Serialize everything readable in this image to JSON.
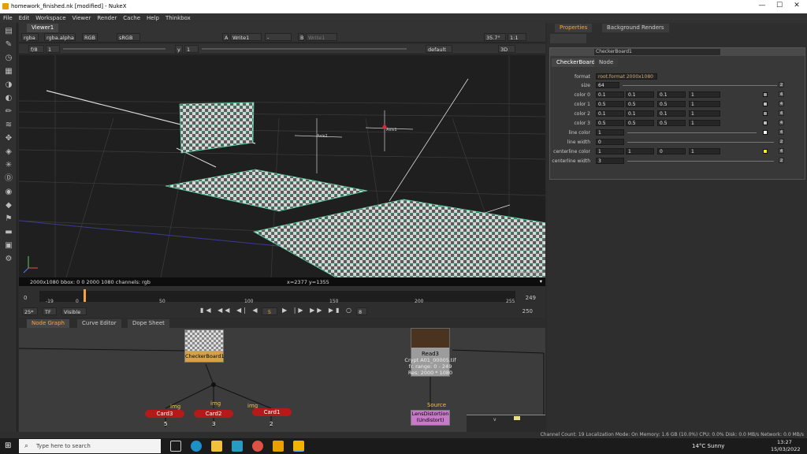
{
  "window": {
    "title": "homework_finished.nk [modified] - NukeX",
    "min": "—",
    "max": "☐",
    "close": "✕"
  },
  "menu": [
    "File",
    "Edit",
    "Workspace",
    "Viewer",
    "Render",
    "Cache",
    "Help",
    "Thinkbox"
  ],
  "viewer": {
    "tab": "Viewer1",
    "channels": "rgba",
    "alpha": "rgba.alpha",
    "colorspace_a": "RGB",
    "lut": "sRGB",
    "input_a_label": "A",
    "input_a": "Write1",
    "input_mid": "-",
    "input_b_label": "B",
    "input_b": "Write1",
    "gain_label": "f/8",
    "gain_val": "1",
    "gamma_label": "y",
    "gamma_val": "1",
    "zoom": "35.7°",
    "ratio": "1:1",
    "camera": "default",
    "mode": "3D",
    "status_left": "2000x1080  bbox: 0 0 2000 1080 channels: rgb",
    "status_mid": "x=2377 y=1355",
    "corner_label": "(2000x1080)",
    "labels": {
      "axis1": "Axis1",
      "axis2": "Axis2"
    }
  },
  "timeline": {
    "start": "0",
    "end": "249",
    "left_in": "-19",
    "right_out": "255",
    "ticks": [
      "0",
      "50",
      "100",
      "150",
      "200",
      "255"
    ],
    "fps": "25*",
    "tf": "TF",
    "visible": "Visible",
    "frame": "5",
    "step": "8",
    "end_frame": "250"
  },
  "properties": {
    "tabs": [
      "Properties",
      "Background Renders"
    ],
    "node_name": "CheckerBoard1",
    "subtabs": [
      "CheckerBoard",
      "Node"
    ],
    "format_label": "format",
    "format_value": "root.format 2000x1080",
    "size_label": "size",
    "size_value": "64",
    "rows": [
      {
        "label": "color 0",
        "v": [
          "0.1",
          "0.1",
          "0.1",
          "1"
        ],
        "chip": "#9a9a9a",
        "n": "4"
      },
      {
        "label": "color 1",
        "v": [
          "0.5",
          "0.5",
          "0.5",
          "1"
        ],
        "chip": "#bdbdbd",
        "n": "4"
      },
      {
        "label": "color 2",
        "v": [
          "0.1",
          "0.1",
          "0.1",
          "1"
        ],
        "chip": "#9a9a9a",
        "n": "4"
      },
      {
        "label": "color 3",
        "v": [
          "0.5",
          "0.5",
          "0.5",
          "1"
        ],
        "chip": "#bdbdbd",
        "n": "4"
      }
    ],
    "line_color_label": "line color",
    "line_color_value": "1",
    "line_color_n": "4",
    "line_width_label": "line width",
    "line_width_value": "0",
    "line_width_n": "2",
    "centerline": {
      "label": "centerline color",
      "v": [
        "1",
        "1",
        "0",
        "1"
      ],
      "chip": "#f4f400",
      "n": "4"
    },
    "centerline_width_label": "centerline width",
    "centerline_width_value": "3",
    "centerline_width_n": "2",
    "size_n": "2",
    "slider_ticks": [
      "0.1",
      "0.2",
      "0.3",
      "0.4",
      "0.5",
      "0.6",
      "0.7",
      "0.8",
      "0.9",
      "1",
      "1.5",
      "2"
    ]
  },
  "nodegraph": {
    "tabs": [
      "Node Graph",
      "Curve Editor",
      "Dope Sheet"
    ],
    "checker": "CheckerBoard1",
    "read": {
      "name": "Read3",
      "line1": "Crypt A01_00005.tif",
      "line2": "fr. range: 0 - 249",
      "line3": "Res: 2000 * 1080"
    },
    "source": "Source",
    "lens": "LensDistortion",
    "lens_sub": "(Undistort)",
    "cards": [
      {
        "name": "Card3",
        "pipe": "img",
        "num": "5"
      },
      {
        "name": "Card2",
        "pipe": "img",
        "num": "3"
      },
      {
        "name": "Card1",
        "pipe": "img",
        "num": "2"
      }
    ],
    "small": "v"
  },
  "status": "Channel Count: 19  Localization Mode: On  Memory: 1.6 GB (10.0%)  CPU: 0.0%  Disk: 0.0 MB/s  Network: 0.0 MB/s",
  "taskbar": {
    "search": "Type here to search",
    "weather": "14°C  Sunny",
    "time": "13:27",
    "date": "15/03/2022"
  },
  "colors": {
    "accent": "#f7a340",
    "card_node": "#b41a1a",
    "lens_node": "#c77ac7",
    "checker_node": "#d4a24a"
  }
}
